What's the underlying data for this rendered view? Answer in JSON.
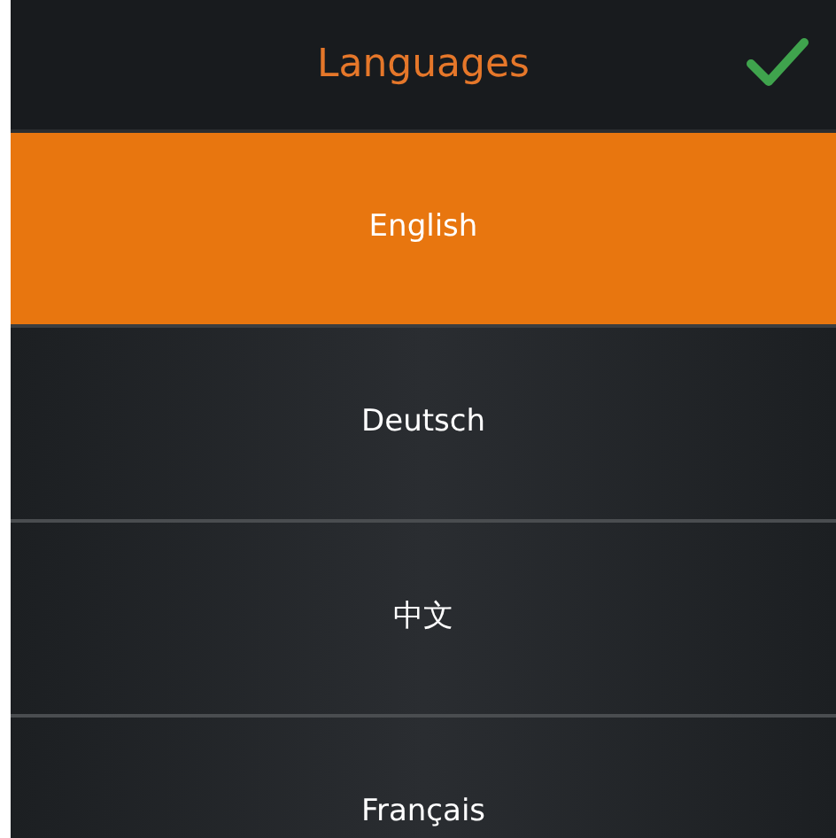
{
  "header": {
    "title": "Languages"
  },
  "languages": [
    {
      "label": "English",
      "selected": true
    },
    {
      "label": "Deutsch",
      "selected": false
    },
    {
      "label": "中文",
      "selected": false
    },
    {
      "label": "Français",
      "selected": false
    }
  ]
}
